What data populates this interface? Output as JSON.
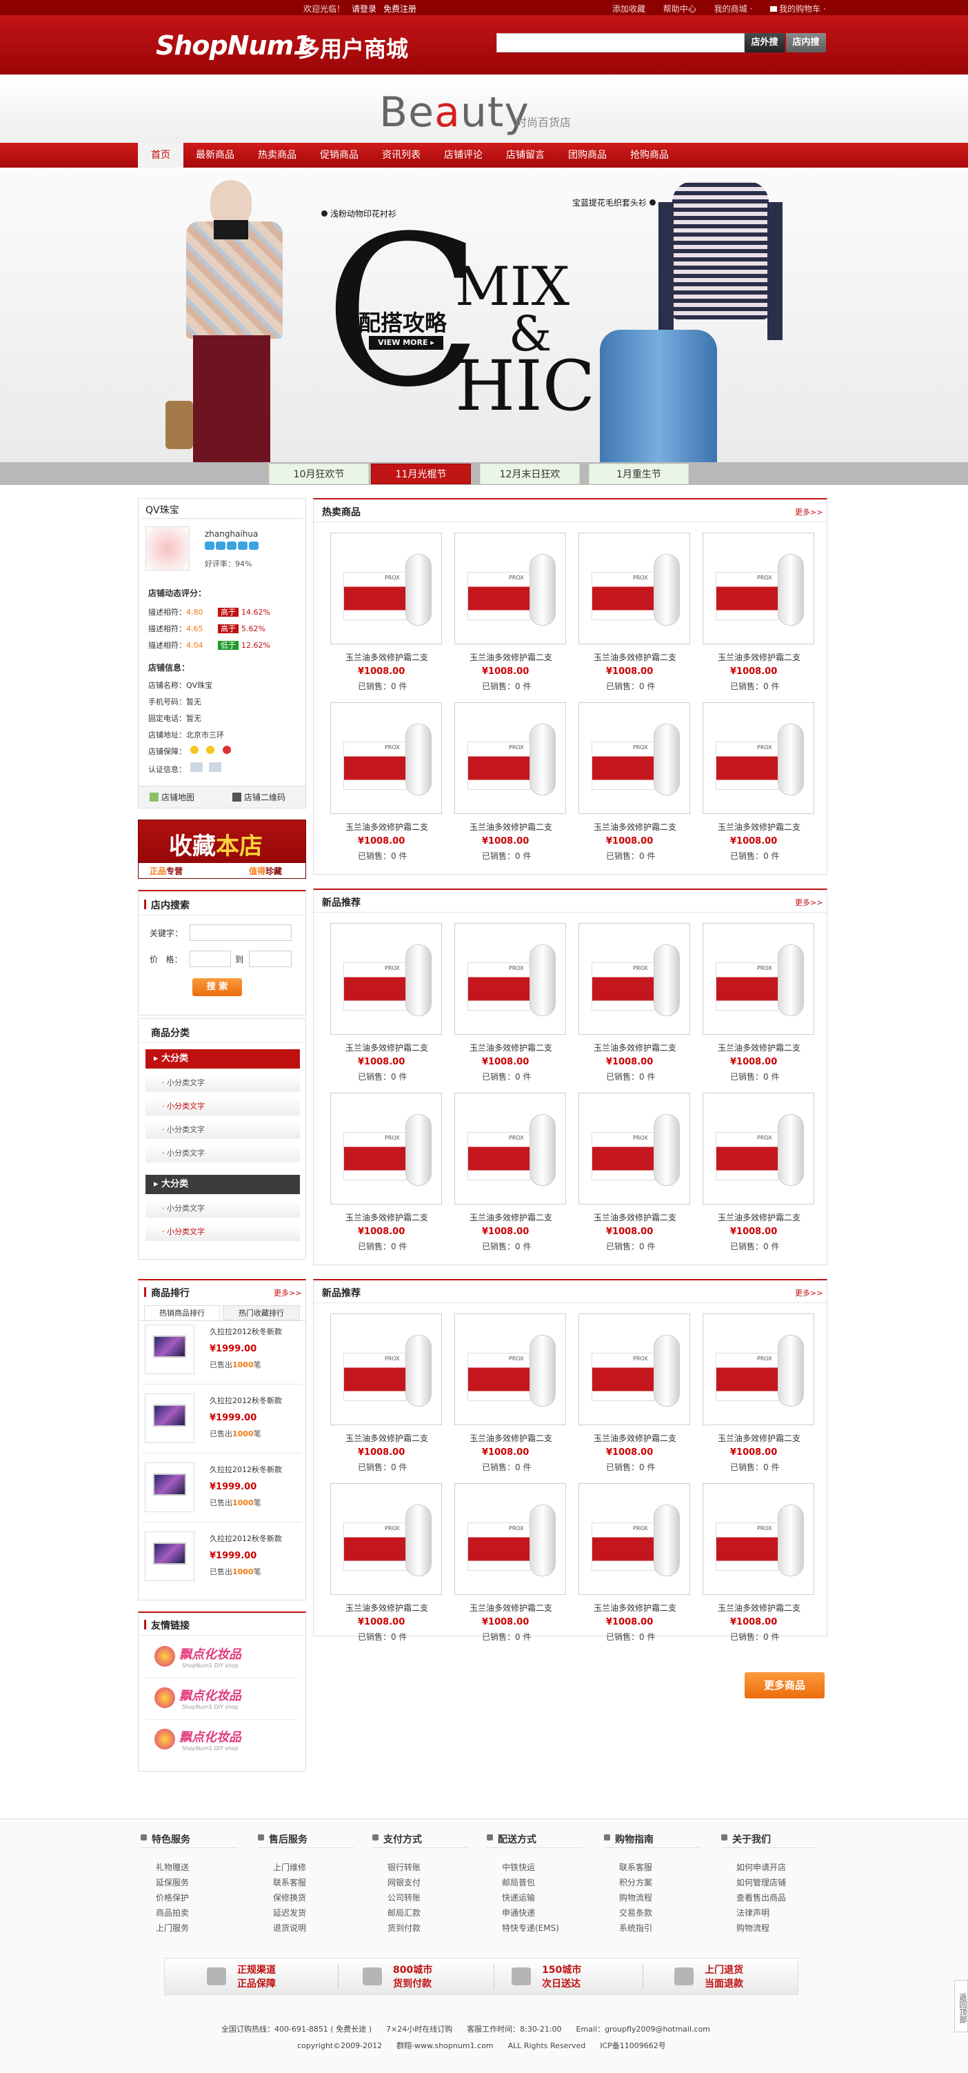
{
  "topbar": {
    "welcome": "欢迎光临！",
    "login": "请登录",
    "register": "免费注册",
    "favorite": "添加收藏",
    "help": "帮助中心",
    "my_mall": "我的商城 ·",
    "cart": "我的购物车 ·"
  },
  "header": {
    "logo": "ShopNum1",
    "logo_cn": "多用户商城",
    "search_placeholder": "",
    "btn_outside": "店外搜",
    "btn_inside": "店内搜"
  },
  "brand": {
    "word_a": "Be",
    "word_b": "a",
    "word_c": "u",
    "word_d": "ty",
    "subtitle": "时尚百货店"
  },
  "nav": [
    "首页",
    "最新商品",
    "热卖商品",
    "促销商品",
    "资讯列表",
    "店铺评论",
    "店铺留言",
    "团购商品",
    "抢购商品"
  ],
  "banner": {
    "label_left": "浅粉动物印花衬衫",
    "label_right": "宝蓝提花毛织套头衫",
    "headline": "配搭攻略",
    "view_more": "VIEW MORE",
    "mix": "MIX",
    "amp": "&",
    "hic": "HIC",
    "c": "C",
    "tabs": [
      "10月狂欢节",
      "11月光棍节",
      "12月末日狂欢",
      "1月重生节"
    ]
  },
  "shop": {
    "title": "QV珠宝",
    "username": "zhanghaihua",
    "praise_label": "好评率：",
    "praise_value": "94%",
    "score_title": "店铺动态评分：",
    "scores": [
      {
        "label": "描述相符：",
        "value": "4.80",
        "tag": "高于",
        "pct": "14.62%",
        "tag_color": "#c01010"
      },
      {
        "label": "描述相符：",
        "value": "4.65",
        "tag": "高于",
        "pct": "5.62%",
        "tag_color": "#c01010"
      },
      {
        "label": "描述相符：",
        "value": "4.04",
        "tag": "低于",
        "pct": "12.62%",
        "tag_color": "#1f9a2b"
      }
    ],
    "info_title": "店铺信息：",
    "info": [
      {
        "label": "店铺名称：",
        "value": "QV珠宝"
      },
      {
        "label": "手机号码：",
        "value": "暂无"
      },
      {
        "label": "固定电话：",
        "value": "暂无"
      },
      {
        "label": "店铺地址：",
        "value": "北京市三环"
      },
      {
        "label": "店铺保障：",
        "value": ""
      },
      {
        "label": "认证信息：",
        "value": ""
      }
    ],
    "map": "店铺地图",
    "qrcode": "店铺二维码"
  },
  "fav": {
    "big_a": "收藏",
    "big_b": "本店",
    "small_a": "正品",
    "small_b": "专营",
    "small_c": "值得",
    "small_d": "珍藏"
  },
  "search": {
    "title": "店内搜索",
    "keyword_label": "关键字：",
    "price_label": "价   格：",
    "to": "到",
    "button": "搜 索"
  },
  "category": {
    "title": "商品分类",
    "groups": [
      {
        "name": "大分类",
        "items": [
          "小分类文字",
          "小分类文字",
          "小分类文字",
          "小分类文字"
        ]
      },
      {
        "name": "大分类",
        "items": [
          "小分类文字",
          "小分类文字"
        ]
      }
    ]
  },
  "ranking": {
    "title": "商品排行",
    "more": "更多>>",
    "tabs": [
      "热销商品排行",
      "热门收藏排行"
    ],
    "items": [
      {
        "name": "久拉拉2012秋冬新款",
        "price": "¥1999.00",
        "sold_a": "已售出",
        "sold_n": "1000",
        "sold_b": "笔"
      },
      {
        "name": "久拉拉2012秋冬新款",
        "price": "¥1999.00",
        "sold_a": "已售出",
        "sold_n": "1000",
        "sold_b": "笔"
      },
      {
        "name": "久拉拉2012秋冬新款",
        "price": "¥1999.00",
        "sold_a": "已售出",
        "sold_n": "1000",
        "sold_b": "笔"
      },
      {
        "name": "久拉拉2012秋冬新款",
        "price": "¥1999.00",
        "sold_a": "已售出",
        "sold_n": "1000",
        "sold_b": "笔"
      }
    ]
  },
  "links": {
    "title": "友情链接",
    "logo_text": "飘点化妆品",
    "logo_sub": "ShopNum1 DIY shop"
  },
  "sections": [
    {
      "title": "热卖商品",
      "more": "更多>>"
    },
    {
      "title": "新品推荐",
      "more": "更多>>"
    },
    {
      "title": "新品推荐",
      "more": "更多>>"
    }
  ],
  "product": {
    "name": "玉兰油多效修护霜二支",
    "price": "¥1008.00",
    "sold": "已销售：0 件",
    "box_text": "PROX"
  },
  "more_goods": "更多商品",
  "footer": {
    "cols": [
      {
        "title": "特色服务",
        "items": [
          "礼物赠送",
          "延保服务",
          "价格保护",
          "商品拍卖",
          "上门服务"
        ]
      },
      {
        "title": "售后服务",
        "items": [
          "上门维修",
          "联系客服",
          "保修换货",
          "延迟发货",
          "退货说明"
        ]
      },
      {
        "title": "支付方式",
        "items": [
          "银行转账",
          "网银支付",
          "公司转账",
          "邮局汇款",
          "货到付款"
        ]
      },
      {
        "title": "配送方式",
        "items": [
          "中铁快运",
          "邮局普包",
          "快递运输",
          "申通快递",
          "特快专递(EMS)"
        ]
      },
      {
        "title": "购物指南",
        "items": [
          "联系客服",
          "积分方案",
          "购物流程",
          "交易条款",
          "系统指引"
        ]
      },
      {
        "title": "关于我们",
        "items": [
          "如何申请开店",
          "如何管理店铺",
          "查看售出商品",
          "法律声明",
          "购物流程"
        ]
      }
    ],
    "promos": [
      {
        "a": "正规渠道",
        "b": "正品保障"
      },
      {
        "a": "800城市",
        "b": "货到付款"
      },
      {
        "a": "150城市",
        "b": "次日送达"
      },
      {
        "a": "上门退货",
        "b": "当面退款"
      }
    ],
    "hotline": "全国订购热线：400-691-8851 ( 免费长途 )",
    "service_time": "7×24小时在线订购",
    "work_time": "客服工作时间：8:30-21:00",
    "email": "Email：groupfly2009@hotmail.com",
    "copyright": "copyright©2009-2012",
    "icp_site": "群翔-www.shopnum1.com",
    "rights": "ALL Rights Reserved",
    "icp": "ICP备11009662号"
  },
  "side_tab": "返回顶部",
  "colors": {
    "brand_red": "#c01010",
    "dark_red": "#8d0000",
    "orange": "#f27a12",
    "grey_tab": "#3c3c3c"
  }
}
